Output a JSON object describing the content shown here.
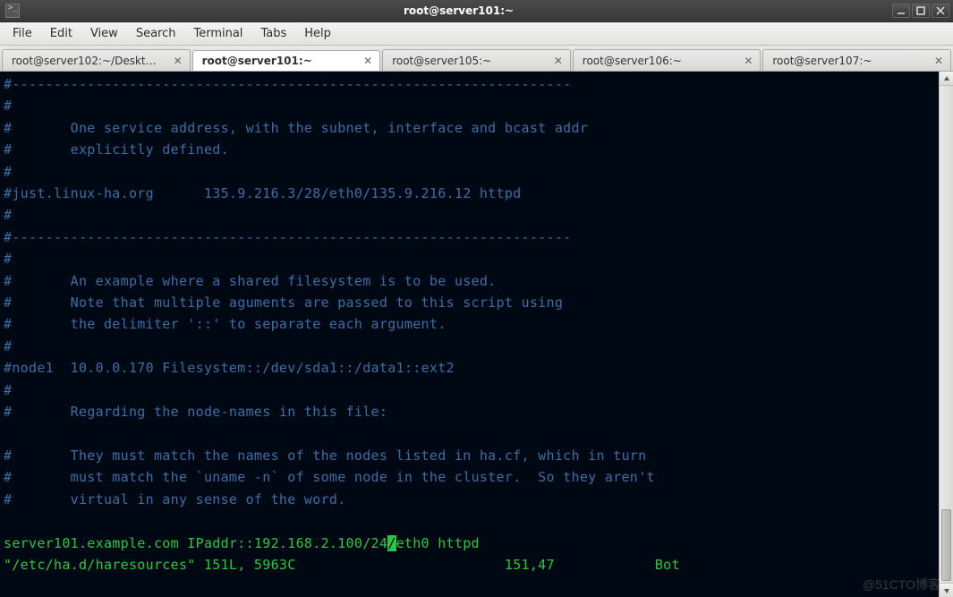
{
  "window": {
    "title": "root@server101:~",
    "buttons": {
      "min": "minimize",
      "max": "maximize",
      "close": "close"
    }
  },
  "menu": {
    "items": [
      "File",
      "Edit",
      "View",
      "Search",
      "Terminal",
      "Tabs",
      "Help"
    ]
  },
  "tabs": [
    {
      "label": "root@server102:~/Deskt…",
      "active": false
    },
    {
      "label": "root@server101:~",
      "active": true
    },
    {
      "label": "root@server105:~",
      "active": false
    },
    {
      "label": "root@server106:~",
      "active": false
    },
    {
      "label": "root@server107:~",
      "active": false
    }
  ],
  "terminal": {
    "lines": [
      "#-------------------------------------------------------------------",
      "#",
      "#       One service address, with the subnet, interface and bcast addr",
      "#       explicitly defined.",
      "#",
      "#just.linux-ha.org      135.9.216.3/28/eth0/135.9.216.12 httpd",
      "#",
      "#-------------------------------------------------------------------",
      "#",
      "#       An example where a shared filesystem is to be used.",
      "#       Note that multiple aguments are passed to this script using",
      "#       the delimiter '::' to separate each argument.",
      "#",
      "#node1  10.0.0.170 Filesystem::/dev/sda1::/data1::ext2",
      "#",
      "#       Regarding the node-names in this file:",
      "",
      "#       They must match the names of the nodes listed in ha.cf, which in turn",
      "#       must match the `uname -n` of some node in the cluster.  So they aren't",
      "#       virtual in any sense of the word.",
      ""
    ],
    "config_line": {
      "pre": "server101.example.com IPaddr::192.168.2.100/24",
      "cur": "/",
      "post": "eth0 httpd"
    },
    "status": {
      "file": "\"/etc/ha.d/haresources\"",
      "info": " 151L, 5963C",
      "pos": "151,47",
      "mode": "Bot"
    }
  },
  "watermark": "@51CTO博客"
}
